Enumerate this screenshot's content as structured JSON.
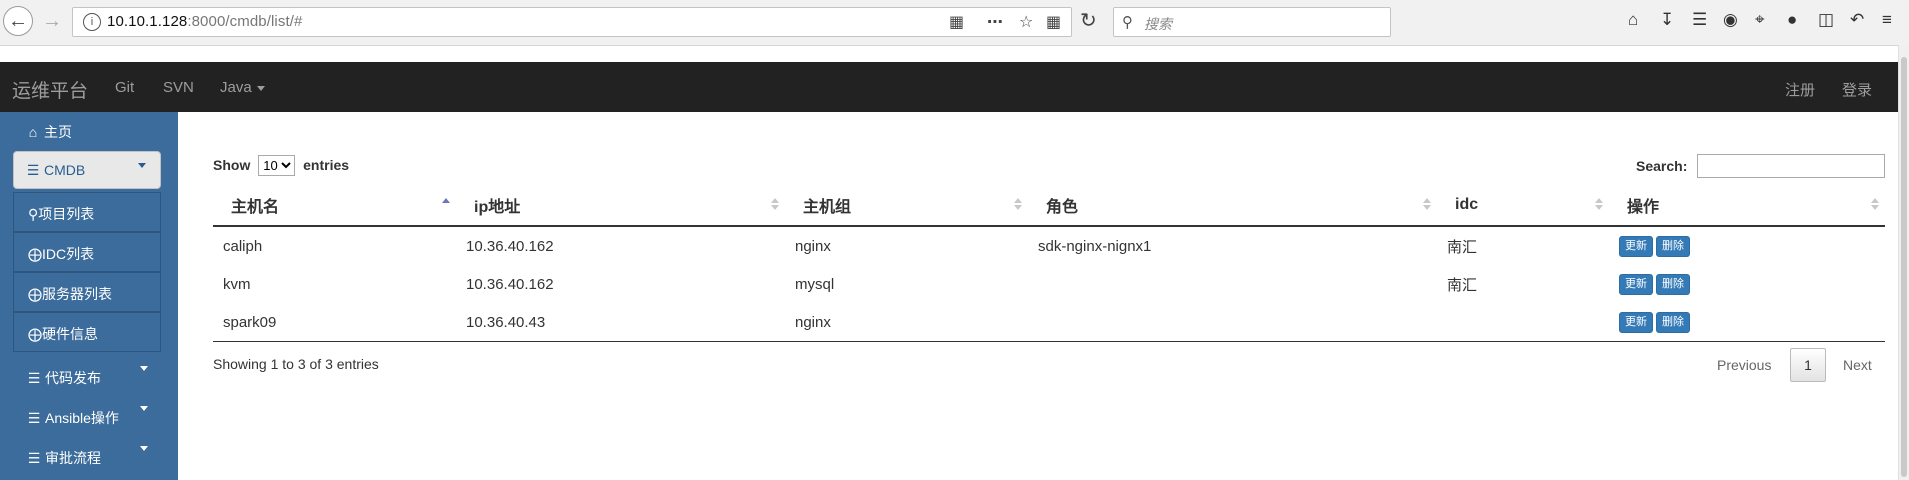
{
  "browser": {
    "url_host": "10.10.1.128",
    "url_path": ":8000/cmdb/list/#",
    "search_placeholder": "搜索"
  },
  "navbar": {
    "brand": "运维平台",
    "links": [
      "Git",
      "SVN",
      "Java"
    ],
    "right_links": [
      "注册",
      "登录"
    ]
  },
  "sidebar": {
    "home": "主页",
    "cmdb": "CMDB",
    "sub_items": [
      "项目列表",
      "IDC列表",
      "服务器列表",
      "硬件信息"
    ],
    "groups": [
      "代码发布",
      "Ansible操作",
      "审批流程"
    ]
  },
  "table_controls": {
    "show_label": "Show",
    "entries_label": "entries",
    "page_length": "10",
    "search_label": "Search:"
  },
  "table": {
    "columns": [
      "主机名",
      "ip地址",
      "主机组",
      "角色",
      "idc",
      "操作"
    ],
    "rows": [
      [
        "caliph",
        "10.36.40.162",
        "nginx",
        "sdk-nginx-nignx1",
        "南汇"
      ],
      [
        "kvm",
        "10.36.40.162",
        "mysql",
        "",
        "南汇"
      ],
      [
        "spark09",
        "10.36.40.43",
        "nginx",
        "",
        ""
      ]
    ],
    "action_update": "更新",
    "action_delete": "删除"
  },
  "footer": {
    "info": "Showing 1 to 3 of 3 entries",
    "previous": "Previous",
    "page": "1",
    "next": "Next"
  },
  "colors": {
    "navbar_bg": "#222222",
    "sidebar_bg": "#3c6c9b",
    "button_primary": "#337ab7"
  }
}
